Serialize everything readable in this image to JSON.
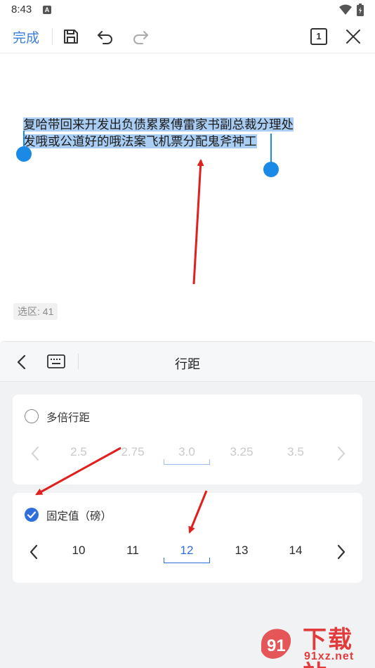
{
  "status_bar": {
    "time": "8:43",
    "notification": "A"
  },
  "toolbar": {
    "done_label": "完成",
    "page_count": "1"
  },
  "document": {
    "selected_lines": [
      "复哈带回来开发出负债累累傅雷家书副总裁分理处",
      "发哦或公道好的哦法案飞机票分配鬼斧神工"
    ],
    "selection_count": "选区: 41"
  },
  "panel": {
    "title": "行距",
    "multiple": {
      "label": "多倍行距",
      "checked": false,
      "values": [
        "2.5",
        "2.75",
        "3.0",
        "3.25",
        "3.5"
      ],
      "selected_index": 2
    },
    "fixed": {
      "label": "固定值（磅）",
      "checked": true,
      "values": [
        "10",
        "11",
        "12",
        "13",
        "14"
      ],
      "selected_index": 2
    }
  },
  "watermark": {
    "brand": "下载站",
    "url": "91xz.net"
  },
  "colors": {
    "accent": "#2f6fdd",
    "selection": "#a9cdf3",
    "handle": "#1a8ae6",
    "annotation": "#e0201e"
  }
}
